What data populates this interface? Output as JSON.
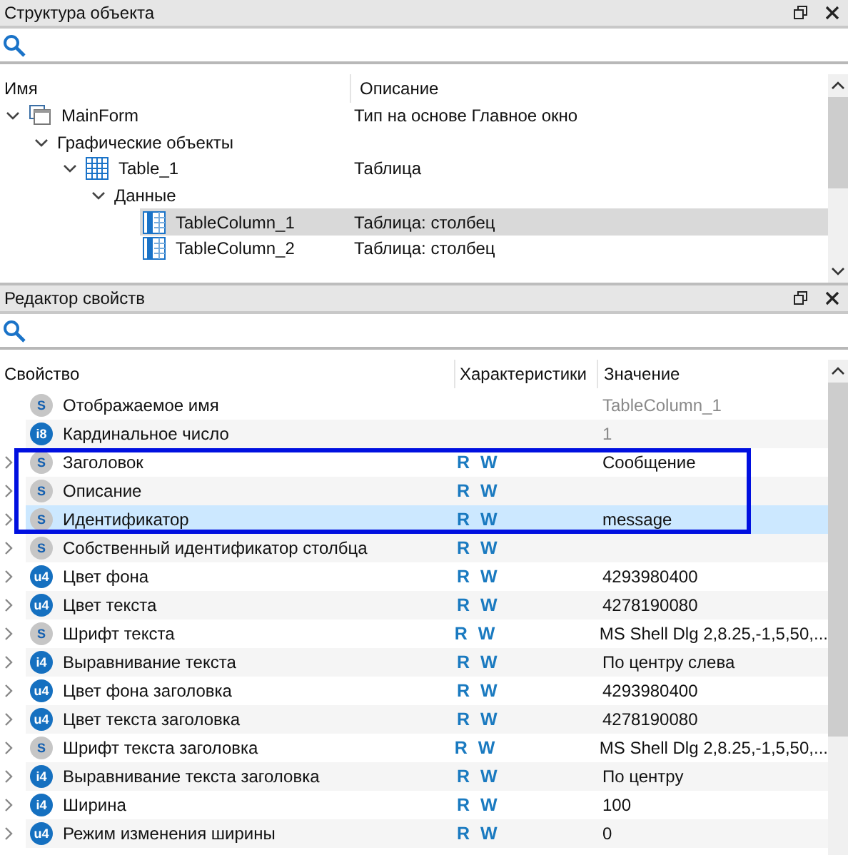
{
  "structure_panel": {
    "title": "Структура объекта",
    "columns": [
      "Имя",
      "Описание"
    ],
    "tree": [
      {
        "name": "MainForm",
        "kind": "form",
        "description": "Тип на основе Главное окно",
        "expanded": true,
        "selected": false,
        "children": [
          {
            "name": "Графические объекты",
            "expanded": true,
            "selected": false,
            "children": [
              {
                "name": "Table_1",
                "kind": "table",
                "description": "Таблица",
                "expanded": true,
                "selected": false,
                "children": [
                  {
                    "name": "Данные",
                    "expanded": true,
                    "selected": false,
                    "children": [
                      {
                        "name": "TableColumn_1",
                        "kind": "column",
                        "description": "Таблица: столбец",
                        "selected": true
                      },
                      {
                        "name": "TableColumn_2",
                        "kind": "column",
                        "description": "Таблица: столбец",
                        "selected": false
                      }
                    ]
                  }
                ]
              }
            ]
          }
        ]
      }
    ]
  },
  "properties_panel": {
    "title": "Редактор свойств",
    "columns": [
      "Свойство",
      "Характеристики",
      "Значение"
    ],
    "rows": [
      {
        "name": "Отображаемое имя",
        "badge": "S",
        "kind": "string",
        "access": "",
        "value": "TableColumn_1",
        "readonly": true,
        "expandable": false,
        "selected": false,
        "framed": false
      },
      {
        "name": "Кардинальное число",
        "badge": "i8",
        "kind": "number",
        "access": "",
        "value": "1",
        "readonly": true,
        "expandable": false,
        "selected": false,
        "framed": false
      },
      {
        "name": "Заголовок",
        "badge": "S",
        "kind": "string",
        "access": "R W",
        "value": "Сообщение",
        "readonly": false,
        "expandable": true,
        "selected": false,
        "framed": true
      },
      {
        "name": "Описание",
        "badge": "S",
        "kind": "string",
        "access": "R W",
        "value": "",
        "expandable": true,
        "selected": false,
        "framed": true
      },
      {
        "name": "Идентификатор",
        "badge": "S",
        "kind": "string",
        "access": "R W",
        "value": "message",
        "readonly": false,
        "expandable": true,
        "selected": true,
        "framed": true
      },
      {
        "name": "Собственный идентификатор столбца",
        "badge": "S",
        "kind": "string",
        "access": "R W",
        "value": "",
        "expandable": true,
        "selected": false,
        "framed": false
      },
      {
        "name": "Цвет фона",
        "badge": "u4",
        "kind": "number",
        "access": "R W",
        "value": "4293980400",
        "readonly": false,
        "expandable": true,
        "selected": false,
        "framed": false
      },
      {
        "name": "Цвет текста",
        "badge": "u4",
        "kind": "number",
        "access": "R W",
        "value": "4278190080",
        "readonly": false,
        "expandable": true,
        "selected": false,
        "framed": false
      },
      {
        "name": "Шрифт текста",
        "badge": "S",
        "kind": "string",
        "access": "R W",
        "value": "MS Shell Dlg 2,8.25,-1,5,50,...",
        "readonly": false,
        "expandable": true,
        "selected": false,
        "framed": false
      },
      {
        "name": "Выравнивание текста",
        "badge": "i4",
        "kind": "number",
        "access": "R W",
        "value": "По центру слева",
        "readonly": false,
        "expandable": true,
        "selected": false,
        "framed": false
      },
      {
        "name": "Цвет фона заголовка",
        "badge": "u4",
        "kind": "number",
        "access": "R W",
        "value": "4293980400",
        "readonly": false,
        "expandable": true,
        "selected": false,
        "framed": false
      },
      {
        "name": "Цвет текста заголовка",
        "badge": "u4",
        "kind": "number",
        "access": "R W",
        "value": "4278190080",
        "readonly": false,
        "expandable": true,
        "selected": false,
        "framed": false
      },
      {
        "name": "Шрифт текста заголовка",
        "badge": "S",
        "kind": "string",
        "access": "R W",
        "value": "MS Shell Dlg 2,8.25,-1,5,50,...",
        "readonly": false,
        "expandable": true,
        "selected": false,
        "framed": false
      },
      {
        "name": "Выравнивание текста заголовка",
        "badge": "i4",
        "kind": "number",
        "access": "R W",
        "value": "По центру",
        "readonly": false,
        "expandable": true,
        "selected": false,
        "framed": false
      },
      {
        "name": "Ширина",
        "badge": "i4",
        "kind": "number",
        "access": "R W",
        "value": "100",
        "readonly": false,
        "expandable": true,
        "selected": false,
        "framed": false
      },
      {
        "name": "Режим изменения ширины",
        "badge": "u4",
        "kind": "number",
        "access": "R W",
        "value": "0",
        "readonly": false,
        "expandable": true,
        "selected": false,
        "framed": false
      }
    ]
  }
}
